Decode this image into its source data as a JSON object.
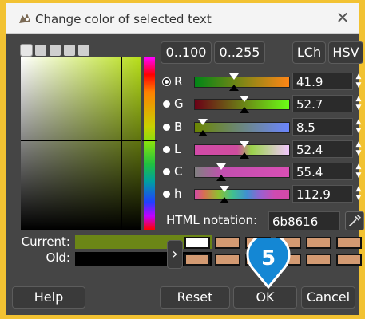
{
  "window": {
    "title": "Change color of selected text"
  },
  "range_buttons": [
    "0..100",
    "0..255"
  ],
  "space_buttons": [
    "LCh",
    "HSV"
  ],
  "channels": [
    {
      "label": "R",
      "value": "41.9",
      "selected": true,
      "level": 0.419,
      "gradient": "linear-gradient(to right,#008616,#ff8616)"
    },
    {
      "label": "G",
      "value": "52.7",
      "selected": false,
      "level": 0.527,
      "gradient": "linear-gradient(to right,#6b0016,#6bff16)"
    },
    {
      "label": "B",
      "value": "8.5",
      "selected": false,
      "level": 0.085,
      "gradient": "linear-gradient(to right,#6b8600,#6b86ff)"
    },
    {
      "label": "L",
      "value": "52.4",
      "selected": false,
      "level": 0.524,
      "gradient": "linear-gradient(to right,#d24aa8,#cf4d9e 45%,#9ad34a 60%,#f2c8ff)"
    },
    {
      "label": "C",
      "value": "55.4",
      "selected": false,
      "level": 0.277,
      "gradient": "linear-gradient(to right,#808080,#c34fb0 30%,#d94fb5)"
    },
    {
      "label": "h",
      "value": "112.9",
      "selected": false,
      "level": 0.314,
      "gradient": "linear-gradient(to right,#d24aa8,#d87050 10%,#8fbf30 25%,#40c090 40%,#4090d0 55%,#9a60d0 70%,#d04ab0 85%,#d24aa8)"
    }
  ],
  "html_notation": {
    "label": "HTML notation:",
    "value": "6b8616"
  },
  "swatches": {
    "current_label": "Current:",
    "old_label": "Old:",
    "current_color": "#6b8616",
    "old_color": "#000000"
  },
  "history": {
    "first_color": "#ffffff",
    "color": "#d39a72"
  },
  "badge": {
    "number": "5"
  },
  "buttons": {
    "help": "Help",
    "reset": "Reset",
    "ok": "OK",
    "cancel": "Cancel"
  },
  "icons": {
    "app": "gimp-wilber-icon",
    "close": "close-icon",
    "picker": "eyedropper-icon"
  }
}
